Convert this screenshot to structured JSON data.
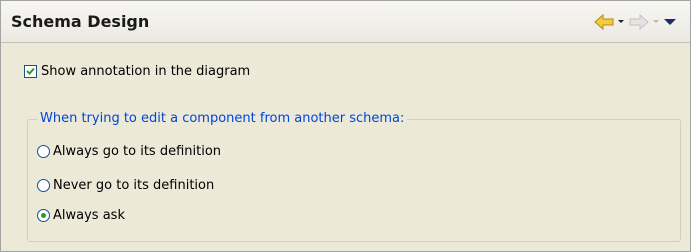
{
  "header": {
    "title": "Schema Design",
    "back_icon": "back-arrow-icon",
    "forward_icon": "forward-arrow-icon",
    "menu_icon": "view-menu-icon"
  },
  "options": {
    "show_annotation": {
      "label": "Show annotation in the diagram",
      "checked": true
    }
  },
  "edit_group": {
    "legend": "When trying to edit a component from another schema:",
    "choices": [
      {
        "label": "Always go to its definition",
        "selected": false
      },
      {
        "label": "Never go to its definition",
        "selected": false
      },
      {
        "label": "Always ask",
        "selected": true
      }
    ]
  },
  "colors": {
    "legend": "#0046d5",
    "nav_back": "#f0c020",
    "radio_selected": "#21a121",
    "checkbox_check": "#21a121"
  }
}
